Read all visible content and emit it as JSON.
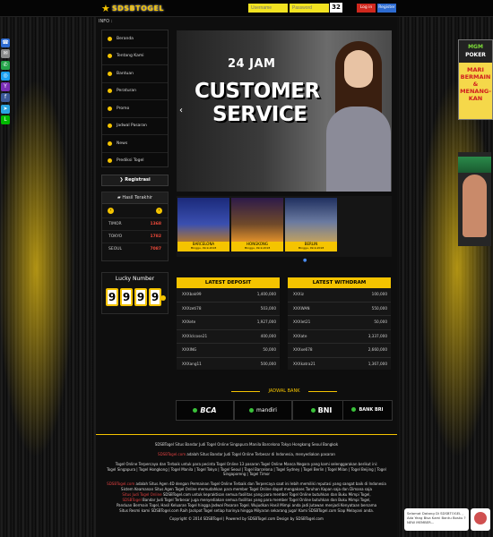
{
  "header": {
    "logo_text": "SDSBTOGEL",
    "username_placeholder": "Username",
    "password_placeholder": "Password",
    "captcha": "32",
    "login_label": "Log in",
    "register_label": "Register"
  },
  "info_label": "INFO :",
  "menu": {
    "items": [
      {
        "label": "Beranda"
      },
      {
        "label": "Tentang Kami"
      },
      {
        "label": "Bantuan"
      },
      {
        "label": "Peraturan"
      },
      {
        "label": "Promo"
      },
      {
        "label": "Jadwal Pasaran"
      },
      {
        "label": "News"
      },
      {
        "label": "Prediksi Togel"
      }
    ]
  },
  "registrasi_label": "Registrasi",
  "hasil": {
    "title": "Hasil Terakhir",
    "rows": [
      {
        "market": "TIMOR",
        "number": "1368"
      },
      {
        "market": "TOKYO",
        "number": "1782"
      },
      {
        "market": "SEOUL",
        "number": "7087"
      }
    ]
  },
  "lucky": {
    "title": "Lucky Number",
    "digits": [
      "9",
      "9",
      "9",
      "9"
    ]
  },
  "banner": {
    "line1": "24 JAM",
    "line2": "CUSTOMER",
    "line3": "SERVICE"
  },
  "thumbs": [
    {
      "city": "BARCELONA",
      "date": "Minggu, 09-9-2018"
    },
    {
      "city": "HONGKONG",
      "date": "Minggu, 09-9-2018"
    },
    {
      "city": "BERLIN",
      "date": "Minggu, 09-9-2018"
    }
  ],
  "deposit": {
    "title": "LATEST DEPOSIT",
    "rows": [
      {
        "user": "XXXbak99",
        "amount": "1,400,000"
      },
      {
        "user": "XXXzeti78",
        "amount": "503,000"
      },
      {
        "user": "XXXete",
        "amount": "1,927,000"
      },
      {
        "user": "XXXlclcose21",
        "amount": "400,000"
      },
      {
        "user": "XXXING",
        "amount": "50,000"
      },
      {
        "user": "XXXang11",
        "amount": "500,000"
      }
    ]
  },
  "withdraw": {
    "title": "LATEST WITHDRAM",
    "rows": [
      {
        "user": "XXXiz",
        "amount": "100,000"
      },
      {
        "user": "XXXWAN",
        "amount": "550,000"
      },
      {
        "user": "XXXlet21",
        "amount": "50,000"
      },
      {
        "user": "XXXate",
        "amount": "3,337,000"
      },
      {
        "user": "XXXxe678",
        "amount": "2,660,000"
      },
      {
        "user": "XXXkatra21",
        "amount": "1,367,000"
      }
    ]
  },
  "jadwal_title": "JADWAL BANK",
  "banks": [
    "BCA",
    "mandiri",
    "BNI",
    "BANK BRI"
  ],
  "footer": {
    "headline": "SDSBTogel Situs Bandar Judi Togel Online Singapura Manila Barcelona Tokyo Hongkong Seoul Bangkok",
    "p1_brand": "SDSBTogel.com",
    "p1": "adalah Situs Bandar Judi Togel Online Terbesar di Indonesia, menyediakan pasaran",
    "p2": "Togel Online Terpercaya dan Terbaik untuk para pecinta Togel Online 13 pasaran Togel Online Manca Negara yang kami selenggarakan berikut ini:",
    "p3": "Togel Singapura | Togel Hongkong | Togel Manila | Togel Tokyo | Togel Seoul | Togel Barcelona | Togel Sydney | Togel Berlin | Togel Milan | Togel Beijing | Togel Singaporeng | Togel Timor",
    "p4_brand": "SDSBTogel.com",
    "p4": "adalah Situs Agen 4D dengan Permainan Togel Online Terbaik dan Terpercaya saat ini lebih memiliki reputasi yang sangat baik di Indonesia",
    "p5": "Sistem Keamanan Situs Agen Togel Online memudahkan para member Togel Online dapat mengakses Taruhan Kapan saja dan Dimana saja",
    "p6_brand": "Situs Judi Togel Online",
    "p6": "SDSBTogel.com untuk kepraktisan semua fasilitas yang para member Togel Online butuhkan dan Buku Mimpi Togel,",
    "p7_brand": "SDSBTogel",
    "p7": "Bandar Judi Togel Terbesar juga menyediakan semua fasilitas yang para member Togel Online butuhkan dan Buku Mimpi Togel,",
    "p8": "Panduan Bermain Togel, Hasil Keluaran Togel hingga Jadwal Pasaran Togel. Wujudkan Hasil Mimpi anda jadi Jutawan menjadi Kenyataan bersama",
    "p9": "Situs Resmi kami SDSBTogel.com Raih Jackpot Togel setiap harinya hingga Milyaran sekarang juga! Kami SDSBTogel.com Siap Melayani anda.",
    "copyright": "Copyright © 2014 SDSBTogel | Powered by SDSBTogel.com Design by SDSBTogel.com"
  },
  "ad_right": {
    "brand1": "MGM",
    "brand2": "POKER",
    "text": "MARI BERMAIN & MENANG-KAN"
  },
  "chat": {
    "text": "Selamat Datang Di SDSBTOGEL , Ada Yang Bisa Kami Bantu Bosku ? NEW MEMBER..."
  },
  "colors": {
    "accent": "#f5c400",
    "login": "#d0281e",
    "register": "#2d6bd1"
  }
}
